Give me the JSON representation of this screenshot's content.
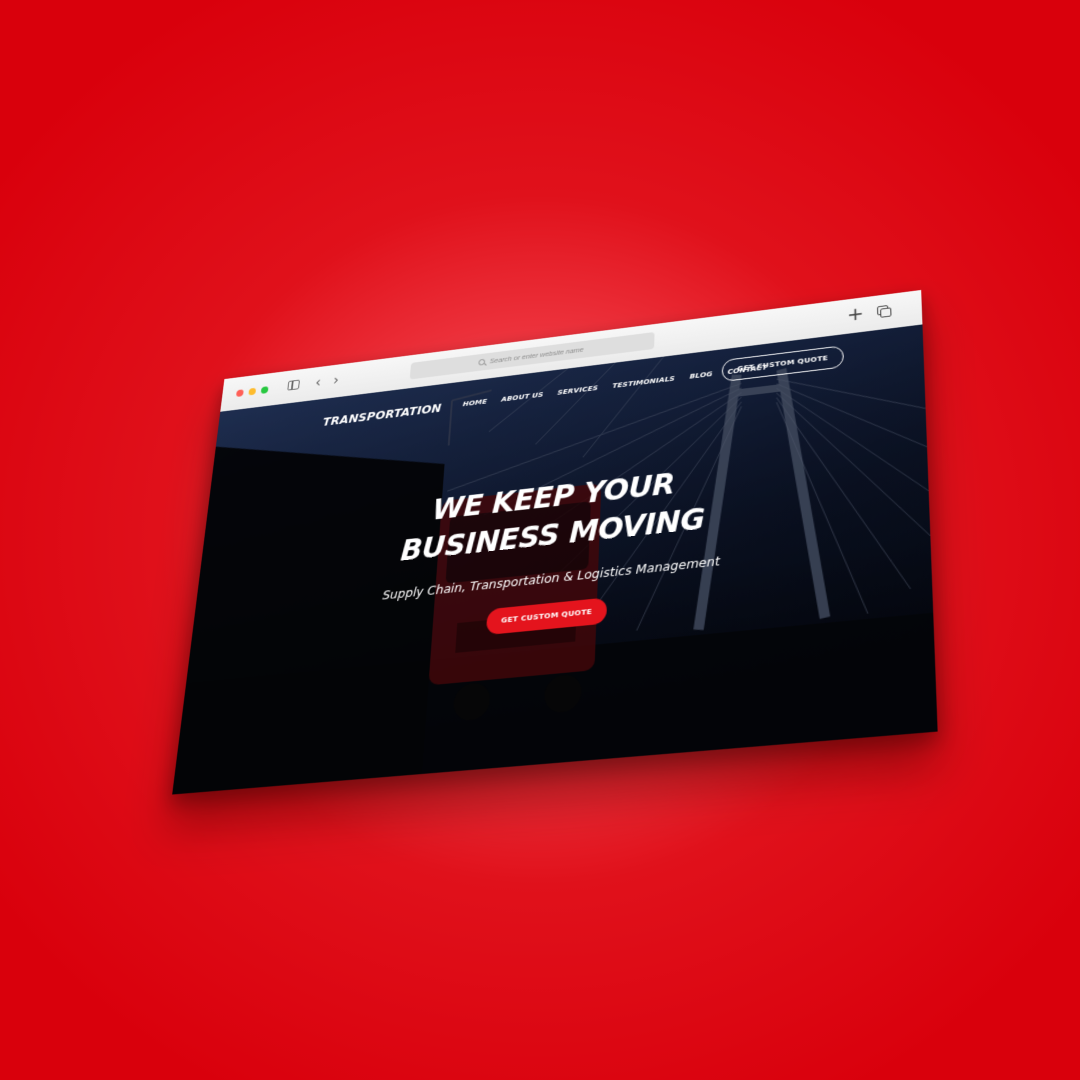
{
  "browser": {
    "address_placeholder": "Search or enter website name",
    "icons": {
      "sidebar": "sidebar-toggle-icon",
      "back": "chevron-left-icon",
      "forward": "chevron-right-icon",
      "search": "search-icon",
      "new_tab": "plus-icon",
      "tabs": "tab-overview-icon"
    },
    "back_glyph": "‹",
    "forward_glyph": "›",
    "plus_glyph": "+"
  },
  "site": {
    "brand": "TRANSPORTATION",
    "nav": [
      {
        "label": "HOME"
      },
      {
        "label": "ABOUT US"
      },
      {
        "label": "SERVICES"
      },
      {
        "label": "TESTIMONIALS"
      },
      {
        "label": "BLOG"
      },
      {
        "label": "CONTACT"
      }
    ],
    "nav_cta": "GET CUSTOM QUOTE",
    "hero": {
      "title_line1": "WE KEEP YOUR",
      "title_line2": "BUSINESS MOVING",
      "subtitle": "Supply Chain, Transportation & Logistics Management",
      "cta": "GET CUSTOM QUOTE"
    }
  },
  "colors": {
    "background": "#d9000c",
    "accent": "#e4141d",
    "traffic_red": "#ff5f57",
    "traffic_yellow": "#febc2e",
    "traffic_green": "#28c840"
  }
}
